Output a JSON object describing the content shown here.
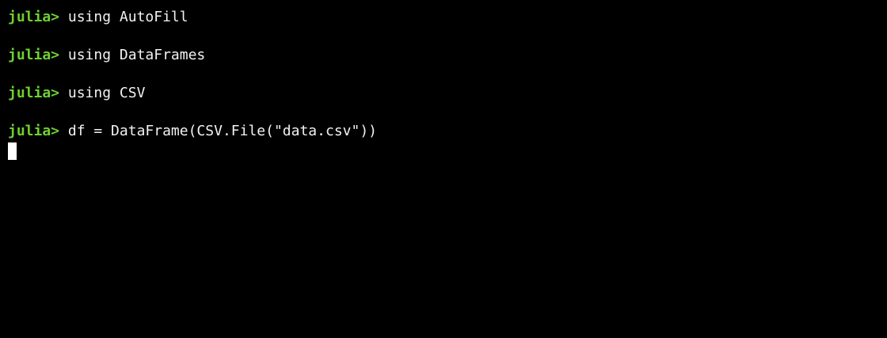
{
  "terminal": {
    "prompt": "julia>",
    "lines": [
      {
        "command": "using AutoFill"
      },
      {
        "command": "using DataFrames"
      },
      {
        "command": "using CSV"
      },
      {
        "command": "df = DataFrame(CSV.File(\"data.csv\"))"
      }
    ]
  },
  "colors": {
    "background": "#000000",
    "prompt": "#6ed032",
    "text": "#f2f2f2",
    "cursor": "#ffffff"
  }
}
